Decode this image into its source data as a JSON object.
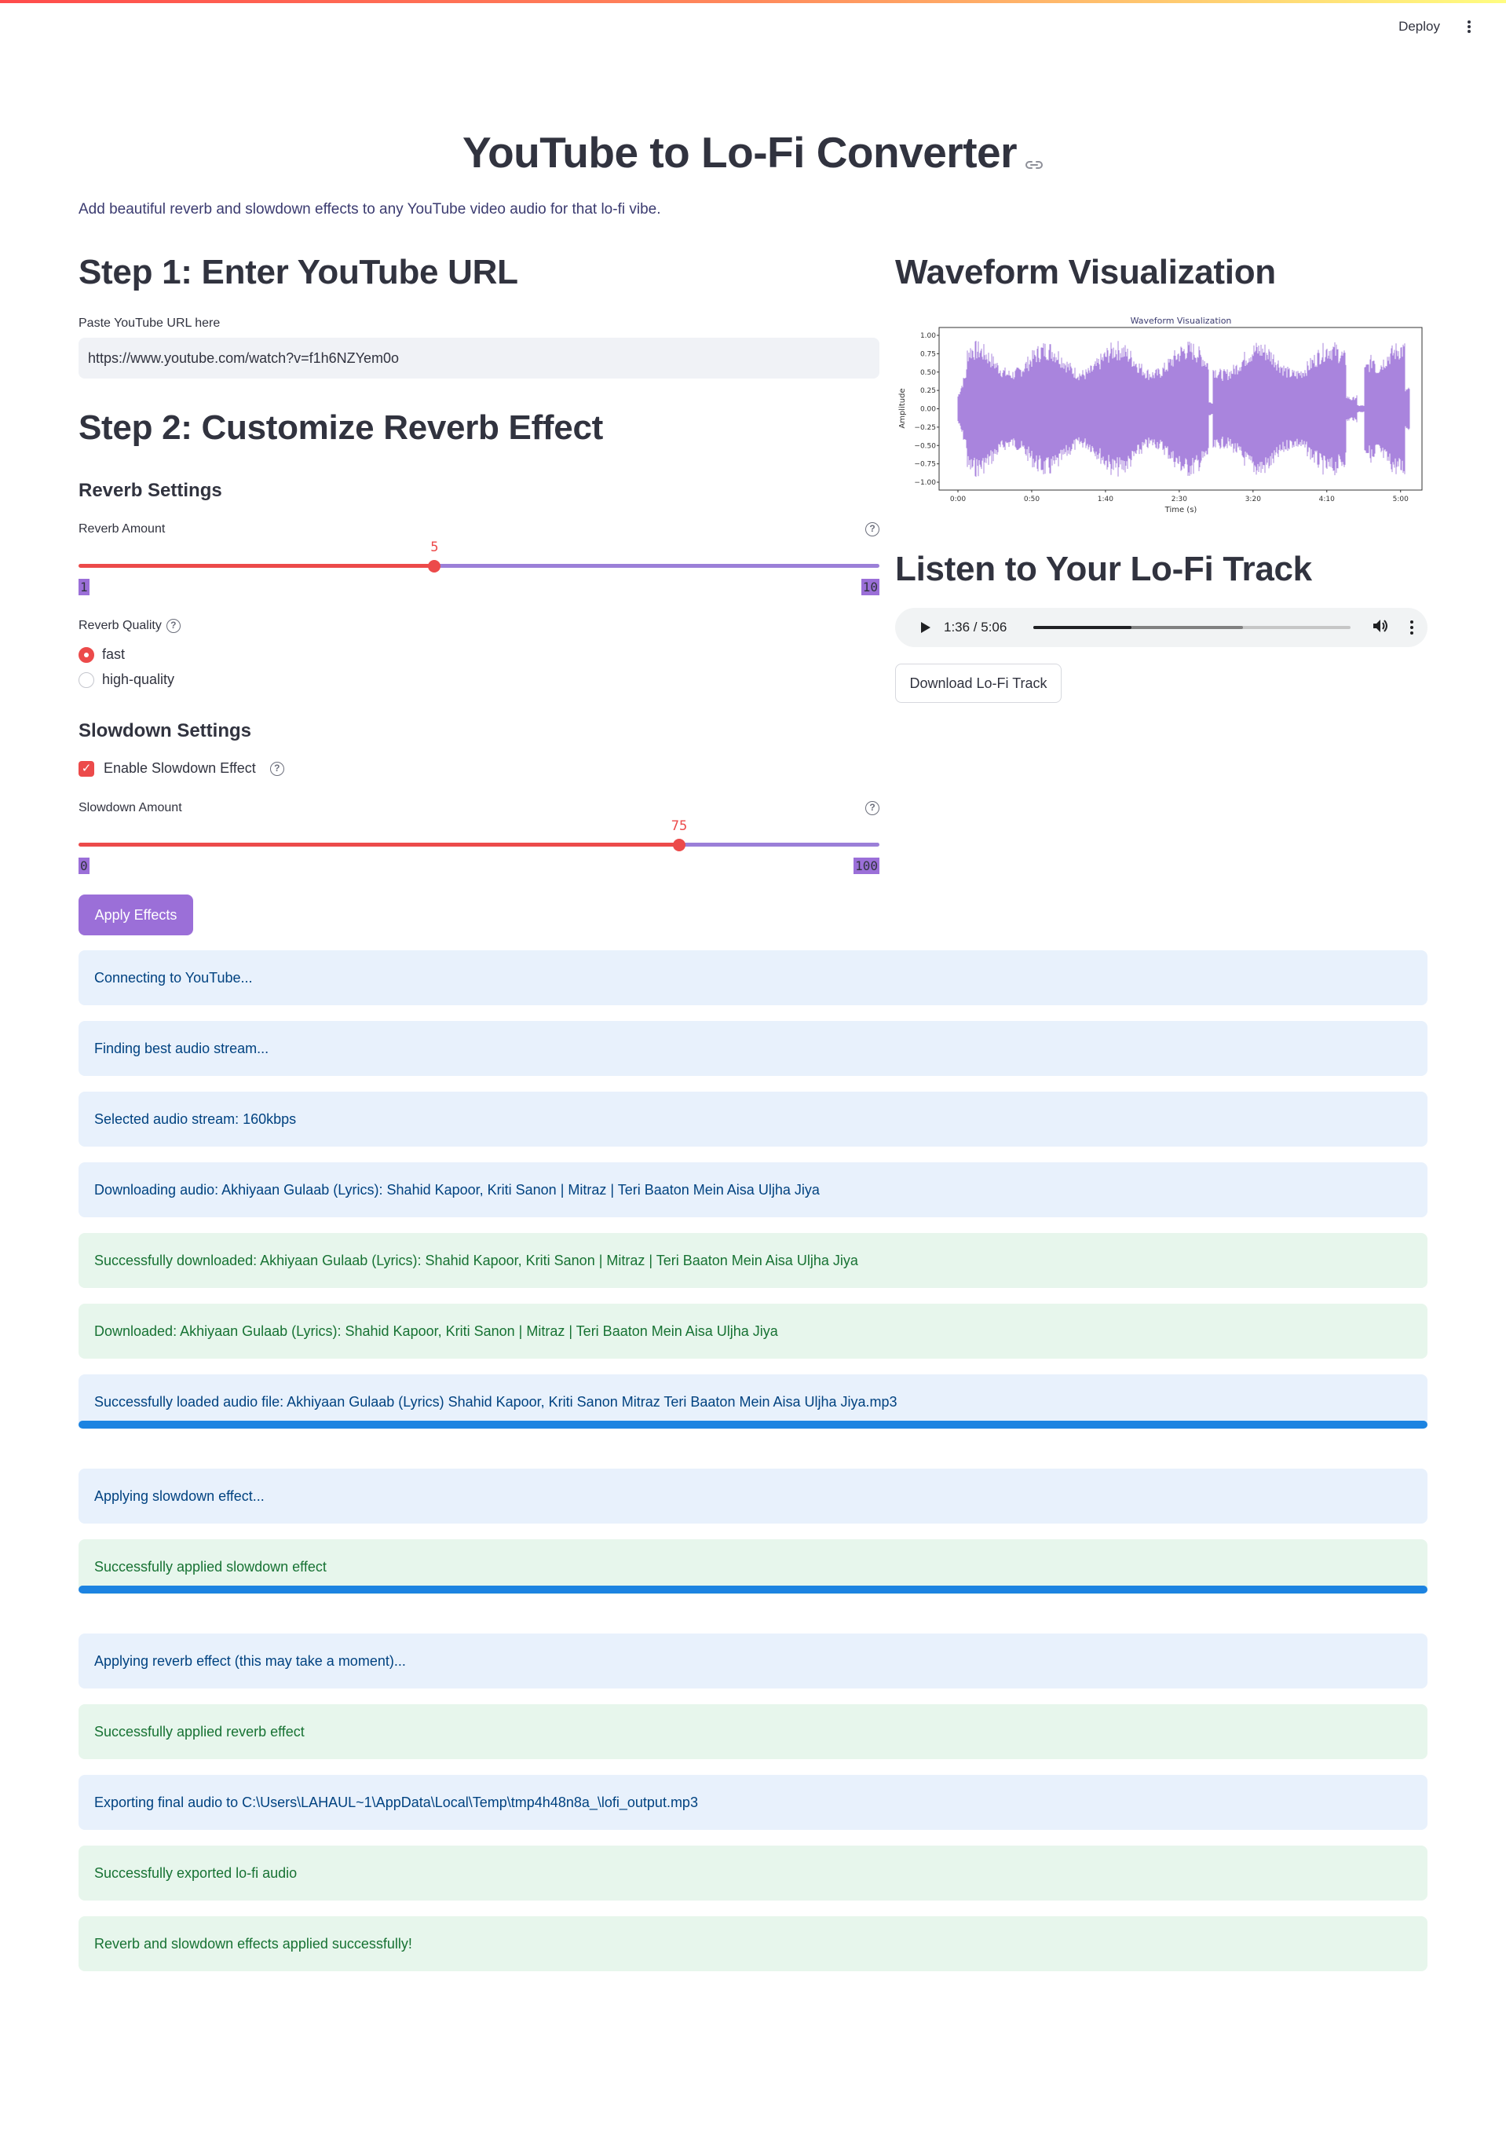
{
  "header": {
    "deploy_label": "Deploy"
  },
  "app": {
    "title": "YouTube to Lo-Fi Converter",
    "subtitle": "Add beautiful reverb and slowdown effects to any YouTube video audio for that lo-fi vibe."
  },
  "step1": {
    "heading": "Step 1: Enter YouTube URL",
    "url_label": "Paste YouTube URL here",
    "url_value": "https://www.youtube.com/watch?v=f1h6NZYem0o"
  },
  "step2": {
    "heading": "Step 2: Customize Reverb Effect",
    "reverb_settings_heading": "Reverb Settings",
    "reverb_amount": {
      "label": "Reverb Amount",
      "value": 5,
      "min": 1,
      "max": 10
    },
    "reverb_quality": {
      "label": "Reverb Quality",
      "options": [
        "fast",
        "high-quality"
      ],
      "selected": "fast"
    },
    "slowdown_settings_heading": "Slowdown Settings",
    "enable_slowdown": {
      "label": "Enable Slowdown Effect",
      "checked": true
    },
    "slowdown_amount": {
      "label": "Slowdown Amount",
      "value": 75,
      "min": 0,
      "max": 100
    },
    "apply_label": "Apply Effects"
  },
  "waveform": {
    "heading": "Waveform Visualization",
    "plot_title": "Waveform Visualization",
    "xlabel": "Time (s)",
    "ylabel": "Amplitude",
    "x_ticks": [
      "0:00",
      "0:50",
      "1:40",
      "2:30",
      "3:20",
      "4:10",
      "5:00"
    ],
    "y_ticks": [
      "1.00",
      "0.75",
      "0.50",
      "0.25",
      "0.00",
      "−0.25",
      "−0.50",
      "−0.75",
      "−1.00"
    ],
    "color": "#9b6fd8"
  },
  "player": {
    "heading": "Listen to Your Lo-Fi Track",
    "time_display": "1:36 / 5:06",
    "played_fraction": 0.31,
    "buffered_fraction": 0.66,
    "download_label": "Download Lo-Fi Track"
  },
  "log": [
    {
      "type": "info",
      "text": "Connecting to YouTube..."
    },
    {
      "type": "info",
      "text": "Finding best audio stream..."
    },
    {
      "type": "info",
      "text": "Selected audio stream: 160kbps"
    },
    {
      "type": "info",
      "text": "Downloading audio: Akhiyaan Gulaab (Lyrics): Shahid Kapoor, Kriti Sanon | Mitraz | Teri Baaton Mein Aisa Uljha Jiya"
    },
    {
      "type": "success",
      "text": "Successfully downloaded: Akhiyaan Gulaab (Lyrics): Shahid Kapoor, Kriti Sanon | Mitraz | Teri Baaton Mein Aisa Uljha Jiya"
    },
    {
      "type": "success",
      "text": "Downloaded: Akhiyaan Gulaab (Lyrics): Shahid Kapoor, Kriti Sanon | Mitraz | Teri Baaton Mein Aisa Uljha Jiya"
    },
    {
      "type": "info",
      "text": "Successfully loaded audio file: Akhiyaan Gulaab (Lyrics) Shahid Kapoor, Kriti Sanon Mitraz Teri Baaton Mein Aisa Uljha Jiya.mp3"
    },
    {
      "type": "progress",
      "value": 1.0
    },
    {
      "type": "info",
      "text": "Applying slowdown effect..."
    },
    {
      "type": "success",
      "text": "Successfully applied slowdown effect"
    },
    {
      "type": "progress",
      "value": 1.0
    },
    {
      "type": "info",
      "text": "Applying reverb effect (this may take a moment)..."
    },
    {
      "type": "success",
      "text": "Successfully applied reverb effect"
    },
    {
      "type": "info",
      "text": "Exporting final audio to C:\\Users\\LAHAUL~1\\AppData\\Local\\Temp\\tmp4h48n8a_\\lofi_output.mp3"
    },
    {
      "type": "success",
      "text": "Successfully exported lo-fi audio"
    },
    {
      "type": "success",
      "text": "Reverb and slowdown effects applied successfully!"
    }
  ],
  "colors": {
    "primary": "#ec4a4a",
    "accent": "#9b6fd8",
    "info_bg": "#e8f1fc",
    "success_bg": "#e7f6ec",
    "progress": "#1c83e1"
  }
}
